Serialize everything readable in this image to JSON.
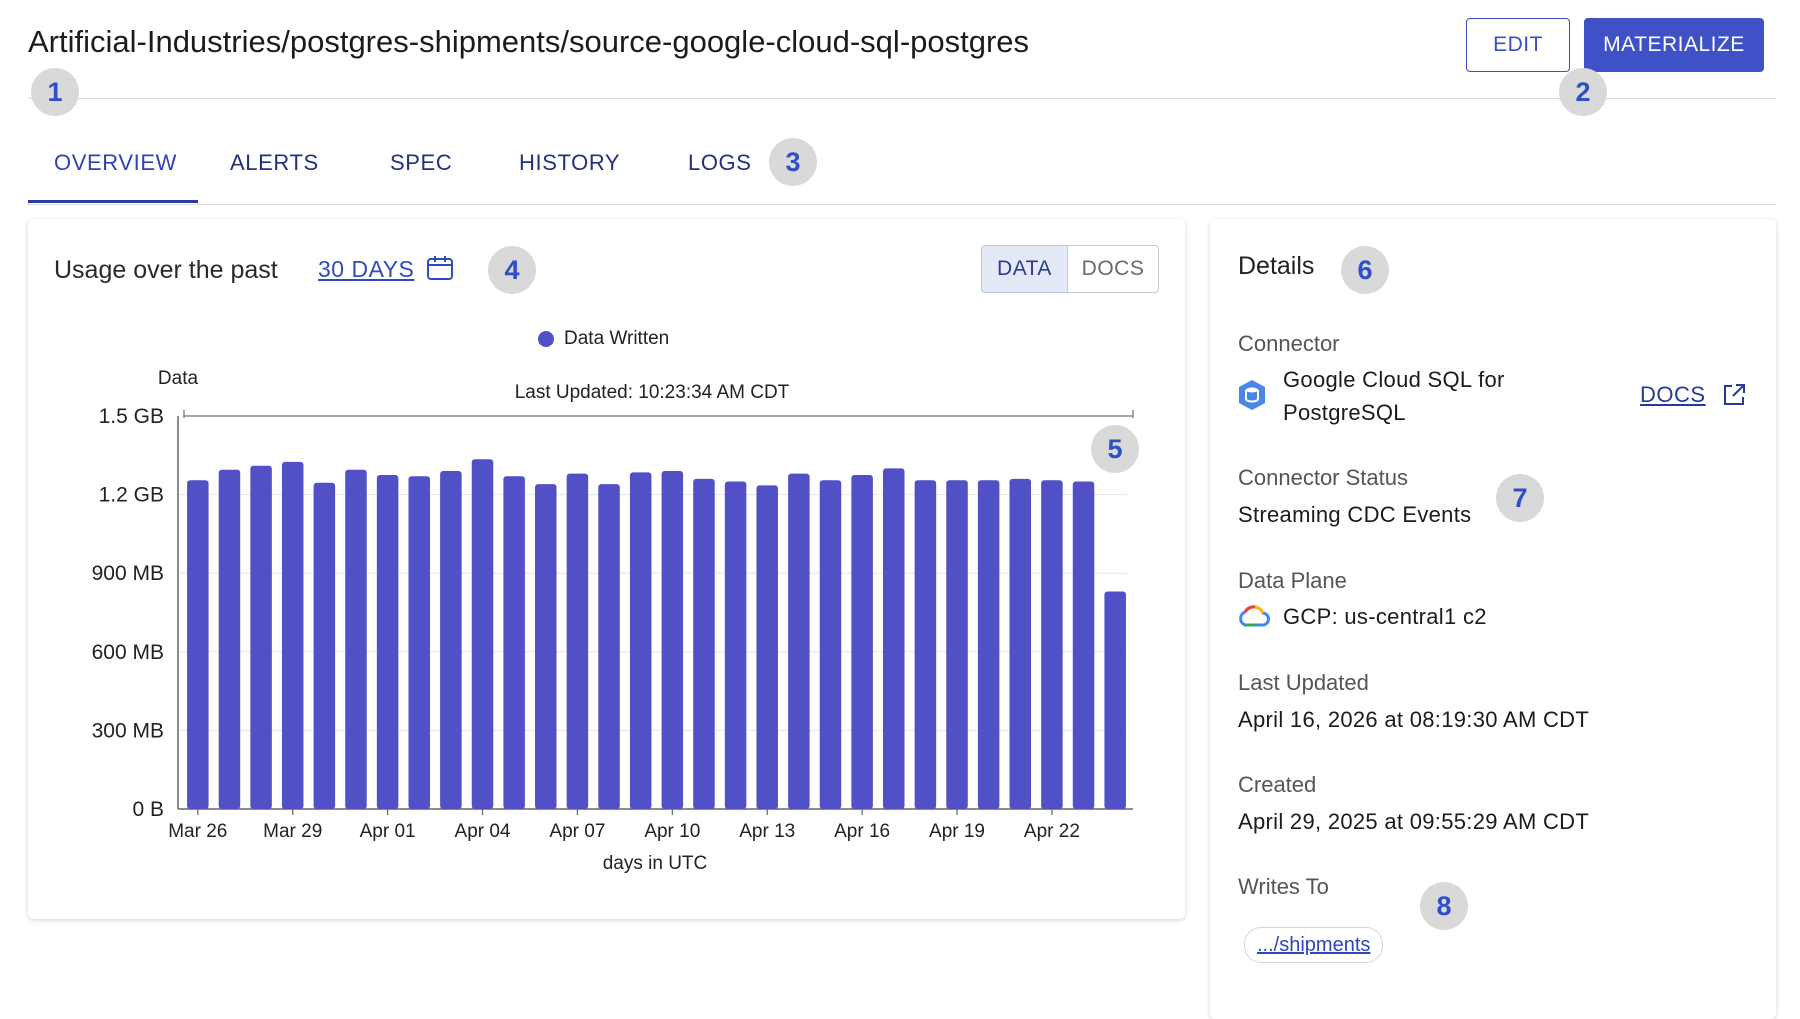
{
  "header": {
    "title": "Artificial-Industries/postgres-shipments/source-google-cloud-sql-postgres",
    "edit_label": "EDIT",
    "materialize_label": "MATERIALIZE"
  },
  "badges": [
    "1",
    "2",
    "3",
    "4",
    "5",
    "6",
    "7",
    "8"
  ],
  "tabs": [
    {
      "label": "OVERVIEW",
      "active": true
    },
    {
      "label": "ALERTS",
      "active": false
    },
    {
      "label": "SPEC",
      "active": false
    },
    {
      "label": "HISTORY",
      "active": false
    },
    {
      "label": "LOGS",
      "active": false
    }
  ],
  "usage": {
    "label": "Usage over the past",
    "range": "30 DAYS",
    "toggle": {
      "data": "DATA",
      "docs": "DOCS",
      "selected": "DATA"
    }
  },
  "chart_data": {
    "type": "bar",
    "legend": [
      "Data Written"
    ],
    "ylabel": "Data",
    "xlabel": "days in UTC",
    "annotation": "Last Updated: 10:23:34 AM CDT",
    "yticks": [
      "0 B",
      "300 MB",
      "600 MB",
      "900 MB",
      "1.2 GB",
      "1.5 GB"
    ],
    "ylim_mb": [
      0,
      1500
    ],
    "xticks": [
      "Mar 26",
      "Mar 29",
      "Apr 01",
      "Apr 04",
      "Apr 07",
      "Apr 10",
      "Apr 13",
      "Apr 16",
      "Apr 19",
      "Apr 22"
    ],
    "categories": [
      "Mar 26",
      "Mar 27",
      "Mar 28",
      "Mar 29",
      "Mar 30",
      "Mar 31",
      "Apr 01",
      "Apr 02",
      "Apr 03",
      "Apr 04",
      "Apr 05",
      "Apr 06",
      "Apr 07",
      "Apr 08",
      "Apr 09",
      "Apr 10",
      "Apr 11",
      "Apr 12",
      "Apr 13",
      "Apr 14",
      "Apr 15",
      "Apr 16",
      "Apr 17",
      "Apr 18",
      "Apr 19",
      "Apr 20",
      "Apr 21",
      "Apr 22",
      "Apr 23",
      "Apr 24"
    ],
    "series": [
      {
        "name": "Data Written",
        "unit": "MB",
        "values": [
          1255,
          1295,
          1310,
          1325,
          1245,
          1295,
          1275,
          1270,
          1290,
          1335,
          1270,
          1240,
          1280,
          1240,
          1285,
          1290,
          1260,
          1250,
          1235,
          1280,
          1255,
          1275,
          1300,
          1255,
          1255,
          1255,
          1260,
          1255,
          1250,
          830
        ]
      }
    ],
    "bar_color": "#5150c6"
  },
  "details": {
    "title": "Details",
    "connector_label": "Connector",
    "connector_value_line1": "Google Cloud SQL for",
    "connector_value_line2": "PostgreSQL",
    "docs_label": "DOCS",
    "status_label": "Connector Status",
    "status_value": "Streaming CDC Events",
    "plane_label": "Data Plane",
    "plane_value": "GCP: us-central1 c2",
    "updated_label": "Last Updated",
    "updated_value": "April 16, 2026 at 08:19:30 AM CDT",
    "created_label": "Created",
    "created_value": "April 29, 2025 at 09:55:29 AM CDT",
    "writes_label": "Writes To",
    "writes_value": ".../shipments"
  },
  "colors": {
    "accent": "#3f51c7",
    "bar": "#5150c6",
    "badge_bg": "#d9d9d9",
    "badge_text": "#2f4fc6"
  }
}
